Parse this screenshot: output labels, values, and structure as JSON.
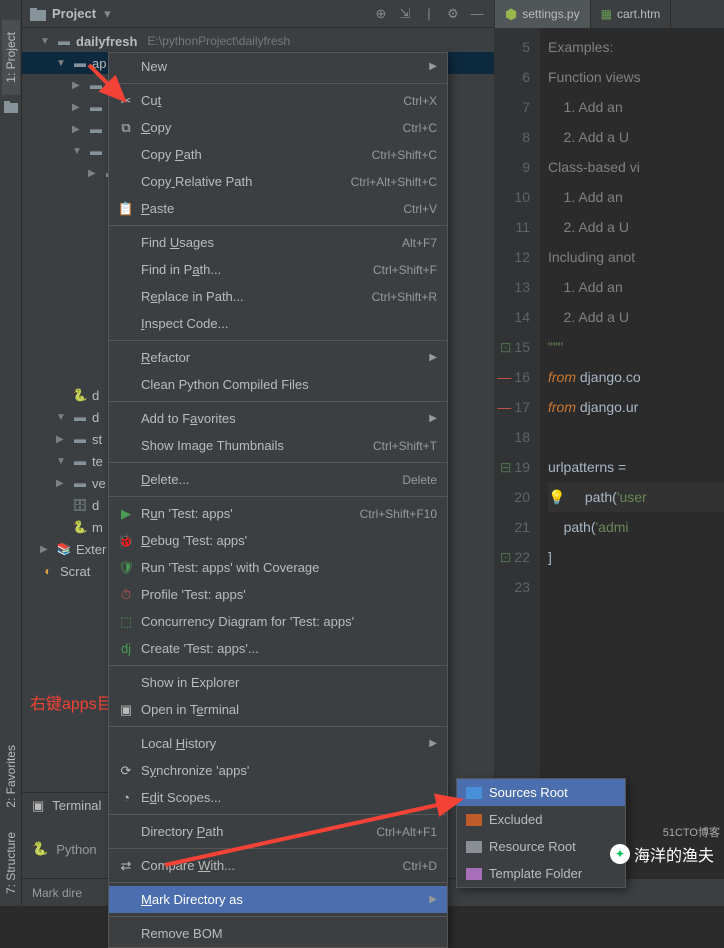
{
  "left_tabs": {
    "project": "1: Project",
    "favorites": "2: Favorites",
    "structure": "7: Structure"
  },
  "toolbar": {
    "title": "Project"
  },
  "tree": {
    "root": {
      "name": "dailyfresh",
      "path": "E:\\pythonProject\\dailyfresh"
    },
    "items": [
      {
        "indent": 2,
        "expanded": true,
        "name": "ap"
      },
      {
        "indent": 3,
        "expanded": false,
        "name": ""
      },
      {
        "indent": 3,
        "expanded": false,
        "name": ""
      },
      {
        "indent": 3,
        "expanded": false,
        "name": ""
      },
      {
        "indent": 3,
        "expanded": true,
        "name": ""
      },
      {
        "indent": 4,
        "expanded": false,
        "name": ""
      }
    ],
    "lower": [
      {
        "indent": 2,
        "name": "d"
      },
      {
        "indent": 2,
        "name": "d"
      },
      {
        "indent": 2,
        "expanded": false,
        "name": "st"
      },
      {
        "indent": 2,
        "expanded": true,
        "name": "te"
      },
      {
        "indent": 2,
        "expanded": false,
        "name": "ve"
      },
      {
        "indent": 3,
        "name": "d"
      },
      {
        "indent": 3,
        "name": "m"
      },
      {
        "indent": 1,
        "name": "Exter"
      },
      {
        "indent": 1,
        "name": "Scrat"
      }
    ]
  },
  "menu": {
    "items": [
      {
        "label": "New",
        "arrow": true
      },
      {
        "sep": true
      },
      {
        "icon": "cut",
        "label": "Cut",
        "u": 2,
        "shortcut": "Ctrl+X"
      },
      {
        "icon": "copy",
        "label": "Copy",
        "u": 0,
        "shortcut": "Ctrl+C"
      },
      {
        "label": "Copy Path",
        "u": 5,
        "shortcut": "Ctrl+Shift+C"
      },
      {
        "label": "Copy Relative Path",
        "u": 4,
        "shortcut": "Ctrl+Alt+Shift+C"
      },
      {
        "icon": "paste",
        "label": "Paste",
        "u": 0,
        "shortcut": "Ctrl+V"
      },
      {
        "sep": true
      },
      {
        "label": "Find Usages",
        "u": 5,
        "shortcut": "Alt+F7"
      },
      {
        "label": "Find in Path...",
        "u": 9,
        "shortcut": "Ctrl+Shift+F"
      },
      {
        "label": "Replace in Path...",
        "u": 1,
        "shortcut": "Ctrl+Shift+R"
      },
      {
        "label": "Inspect Code...",
        "u": 0
      },
      {
        "sep": true
      },
      {
        "label": "Refactor",
        "u": 0,
        "arrow": true
      },
      {
        "label": "Clean Python Compiled Files"
      },
      {
        "sep": true
      },
      {
        "label": "Add to Favorites",
        "u": 8,
        "arrow": true
      },
      {
        "label": "Show Image Thumbnails",
        "shortcut": "Ctrl+Shift+T"
      },
      {
        "sep": true
      },
      {
        "label": "Delete...",
        "u": 0,
        "shortcut": "Delete"
      },
      {
        "sep": true
      },
      {
        "icon": "run",
        "label": "Run 'Test: apps'",
        "u": 1,
        "shortcut": "Ctrl+Shift+F10"
      },
      {
        "icon": "debug",
        "label": "Debug 'Test: apps'",
        "u": 0
      },
      {
        "icon": "coverage",
        "label": "Run 'Test: apps' with Coverage"
      },
      {
        "icon": "profile",
        "label": "Profile 'Test: apps'"
      },
      {
        "icon": "concurrency",
        "label": "Concurrency Diagram for 'Test: apps'"
      },
      {
        "icon": "dj",
        "label": "Create 'Test: apps'..."
      },
      {
        "sep": true
      },
      {
        "label": "Show in Explorer"
      },
      {
        "icon": "terminal",
        "label": "Open in Terminal",
        "u": 9
      },
      {
        "sep": true
      },
      {
        "label": "Local History",
        "u": 6,
        "arrow": true
      },
      {
        "icon": "sync",
        "label": "Synchronize 'apps'",
        "u": 1
      },
      {
        "icon": "scopes",
        "label": "Edit Scopes...",
        "u": 1
      },
      {
        "sep": true
      },
      {
        "label": "Directory Path",
        "u": 10,
        "shortcut": "Ctrl+Alt+F1"
      },
      {
        "sep": true
      },
      {
        "icon": "compare",
        "label": "Compare With...",
        "u": 8,
        "shortcut": "Ctrl+D"
      },
      {
        "sep": true
      },
      {
        "label": "Mark Directory as",
        "u": 0,
        "arrow": true,
        "highlight": true
      },
      {
        "sep": true
      },
      {
        "label": "Remove BOM"
      }
    ]
  },
  "submenu": {
    "items": [
      {
        "color": "#4a90d9",
        "label": "Sources Root",
        "highlight": true
      },
      {
        "color": "#c05b2c",
        "label": "Excluded"
      },
      {
        "color": "#8a8f96",
        "label": "Resource Root"
      },
      {
        "color": "#a76fb9",
        "label": "Template Folder"
      }
    ]
  },
  "tabs": [
    {
      "type": "py",
      "label": "settings.py",
      "active": true
    },
    {
      "type": "html",
      "label": "cart.htm",
      "active": false
    }
  ],
  "code": {
    "start": 5,
    "lines": [
      {
        "n": 5,
        "t": "Examples:",
        "cls": "c-comment"
      },
      {
        "n": 6,
        "t": "Function views",
        "cls": "c-comment"
      },
      {
        "n": 7,
        "t": "    1. Add an ",
        "cls": "c-comment"
      },
      {
        "n": 8,
        "t": "    2. Add a U",
        "cls": "c-comment"
      },
      {
        "n": 9,
        "t": "Class-based vi",
        "cls": "c-comment"
      },
      {
        "n": 10,
        "t": "    1. Add an ",
        "cls": "c-comment"
      },
      {
        "n": 11,
        "t": "    2. Add a U",
        "cls": "c-comment"
      },
      {
        "n": 12,
        "t": "Including anot",
        "cls": "c-comment"
      },
      {
        "n": 13,
        "t": "    1. Add an ",
        "cls": "c-comment"
      },
      {
        "n": 14,
        "t": "    2. Add a U",
        "cls": "c-comment"
      },
      {
        "n": 15,
        "t": "\"\"\"",
        "cls": "c-str",
        "fold": "close"
      },
      {
        "n": 16,
        "kw": "from",
        "rest": " django.co",
        "fold": "dash"
      },
      {
        "n": 17,
        "kw": "from",
        "rest": " django.ur",
        "fold": "dash"
      },
      {
        "n": 18,
        "t": ""
      },
      {
        "n": 19,
        "id": "urlpatterns",
        "op": " = ",
        "fold": "open"
      },
      {
        "n": 20,
        "indent": "    ",
        "bulb": true,
        "fn": "path",
        "arg": "('user"
      },
      {
        "n": 21,
        "indent": "    ",
        "fn": "path",
        "arg": "('admi"
      },
      {
        "n": 22,
        "t": "]",
        "fold": "close"
      },
      {
        "n": 23,
        "t": ""
      }
    ]
  },
  "annotation": "右键apps目录",
  "bottom": {
    "terminal": "Terminal",
    "console": "Python"
  },
  "breadcrumb": "Mark dire",
  "watermark": "海洋的渔夫",
  "watermark_blog": "51CTO博客"
}
